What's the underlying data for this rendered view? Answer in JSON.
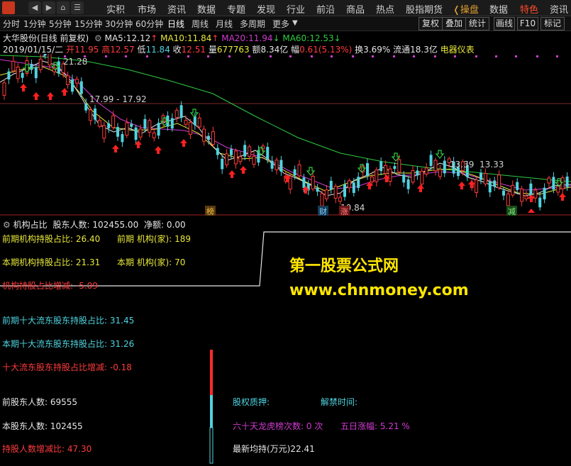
{
  "top_menu": {
    "items": [
      "实积",
      "市场",
      "资讯",
      "数据",
      "专题",
      "发现",
      "行业",
      "前沿",
      "商品",
      "热点",
      "股指期货"
    ],
    "right_items": [
      "操盘",
      "数据",
      "特色",
      "资讯"
    ],
    "active_right": "特色",
    "back_icon": "back-arrow-icon",
    "forward_icon": "forward-arrow-icon"
  },
  "period_bar": {
    "periods": [
      "分时",
      "1分钟",
      "5分钟",
      "15分钟",
      "30分钟",
      "60分钟",
      "日线",
      "周线",
      "月线",
      "多周期",
      "更多"
    ],
    "active": "日线",
    "tools": [
      "复权",
      "叠加",
      "统计",
      "画线",
      "F10",
      "标记"
    ]
  },
  "quote_header": {
    "stock_name": "大华股份(日线 前复权)",
    "ma5_label": "MA5:",
    "ma5_value": "12.12",
    "ma10_label": "MA10:",
    "ma10_value": "11.84",
    "ma20_label": "MA20:",
    "ma20_value": "11.94",
    "ma60_label": "MA60:",
    "ma60_value": "12.53",
    "date": "2019/01/15/二",
    "open_label": "开",
    "open": "11.95",
    "high_label": "高",
    "high": "12.57",
    "low_label": "低",
    "low": "11.84",
    "close_label": "收",
    "close": "12.51",
    "volume_label": "量",
    "volume": "677763",
    "amount_label": "额",
    "amount": "8.34亿",
    "change_label": "幅",
    "change": "0.61(5.13%)",
    "turnover_label": "换",
    "turnover": "3.69%",
    "float_label": "流通",
    "float_cap": "18.3亿",
    "industry": "电器仪表"
  },
  "candle_chart": {
    "price_labels": [
      "21.28",
      "17.99 - 17.92",
      "13.39",
      "13.33",
      "10.84"
    ],
    "badges": [
      "榜",
      "财",
      "涨",
      "减"
    ]
  },
  "indicator_panel": {
    "title": "机构占比",
    "shareholders_label": "股东人数:",
    "shareholders_value": "102455.00",
    "net_amount_label": "净额:",
    "net_amount_value": "0.00",
    "prev_inst_ratio_label": "前期机构持股占比:",
    "prev_inst_ratio": "26.40",
    "prev_inst_count_label": "前期  机构(家):",
    "prev_inst_count": "189",
    "curr_inst_ratio_label": "本期机构持股占比:",
    "curr_inst_ratio": "21.31",
    "curr_inst_count_label": "本期  机构(家):",
    "curr_inst_count": "70",
    "inst_change_label": "机构持股占比增减:",
    "inst_change": "-5.09",
    "watermark_line1": "第一股票公式网",
    "watermark_line2": "www.chnmoney.com",
    "prev_top10_label": "前期十大流东股东持股占比:",
    "prev_top10": "31.45",
    "curr_top10_label": "本期十大流东股东持股占比:",
    "curr_top10": "31.26",
    "top10_change_label": "十大流东股东持股占比增减:",
    "top10_change": "-0.18",
    "prev_holders_label": "前股东人数:",
    "prev_holders": "69555",
    "curr_holders_label": "本股东人数:",
    "curr_holders": "102455",
    "holders_change_label": "持股人数增减比:",
    "holders_change": "47.30",
    "pledge_label": "股权质押:",
    "unlock_label": "解禁时间:",
    "dragon_label": "六十天龙虎榜次数:",
    "dragon_value": "0 次",
    "five_day_label": "五日涨幅:",
    "five_day_value": "5.21 %",
    "avg_hold_label": "最新均持(万元)",
    "avg_hold_value": "22.41"
  },
  "colors": {
    "up": "#ff3b3b",
    "down": "#4fd3e0",
    "ma5": "#e6e6e6",
    "ma10": "#e8e83a",
    "ma20": "#d13bd1",
    "ma60": "#2ecc40",
    "signal_up": "#ff2020",
    "signal_down": "#2ecc40"
  }
}
